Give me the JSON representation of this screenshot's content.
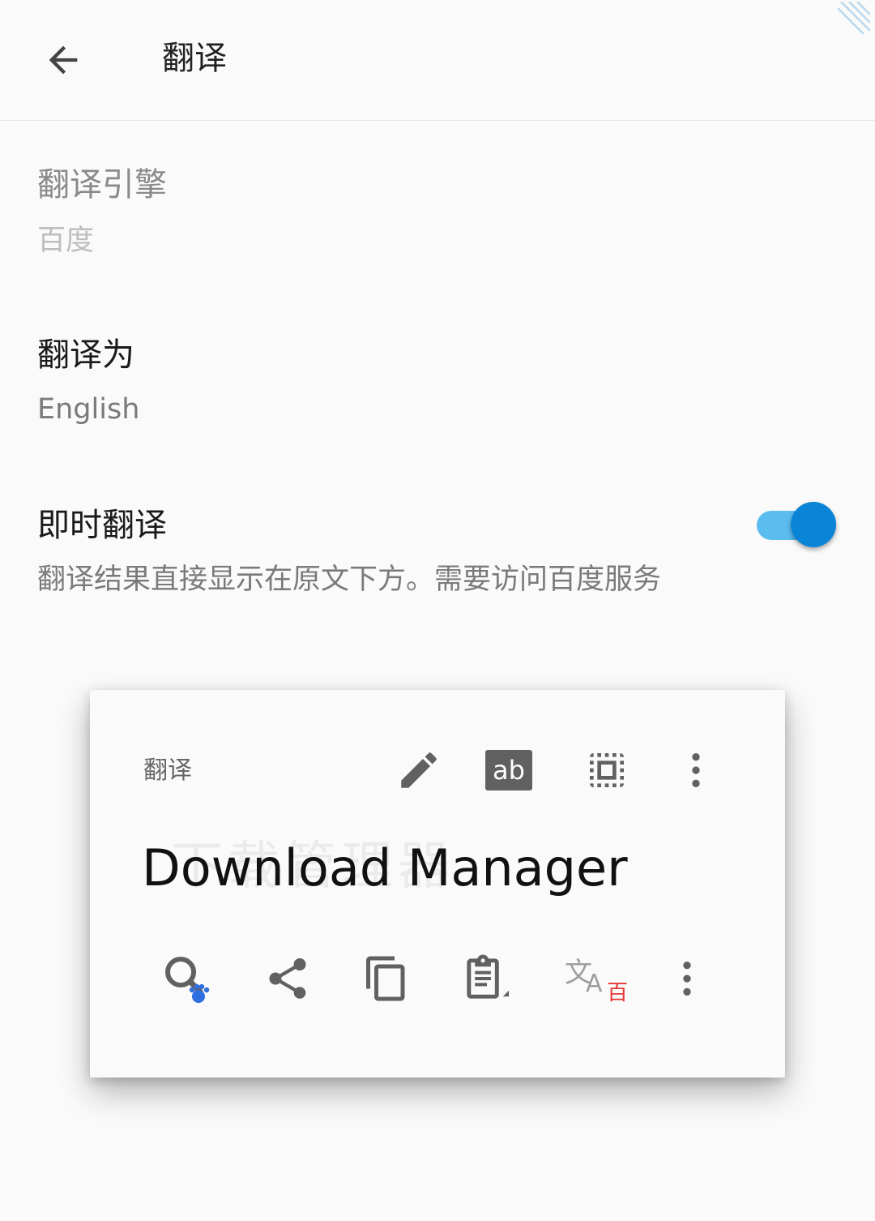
{
  "appbar": {
    "title": "翻译",
    "back_icon": "arrow-left-icon"
  },
  "prefs": {
    "engine": {
      "title": "翻译引擎",
      "summary": "百度"
    },
    "target": {
      "title": "翻译为",
      "summary": "English"
    },
    "instant": {
      "title": "即时翻译",
      "summary": "翻译结果直接显示在原文下方。需要访问百度服务",
      "enabled": true
    }
  },
  "card": {
    "label": "翻译",
    "ghost_text": "下载管理器",
    "text": "Download Manager",
    "ab_label": "ab",
    "top_icons": [
      "pencil-icon",
      "ab-icon",
      "select-all-icon",
      "more-vert-icon"
    ],
    "bottom_icons": [
      "baidu-search-icon",
      "share-icon",
      "copy-icon",
      "paste-icon",
      "translate-icon",
      "more-vert-icon"
    ],
    "translate_badge": "百"
  },
  "colors": {
    "accent": "#0a84d6",
    "switch_track": "#5bbcef",
    "baidu_blue": "#2f6fe0",
    "badge_red": "#e53935"
  }
}
